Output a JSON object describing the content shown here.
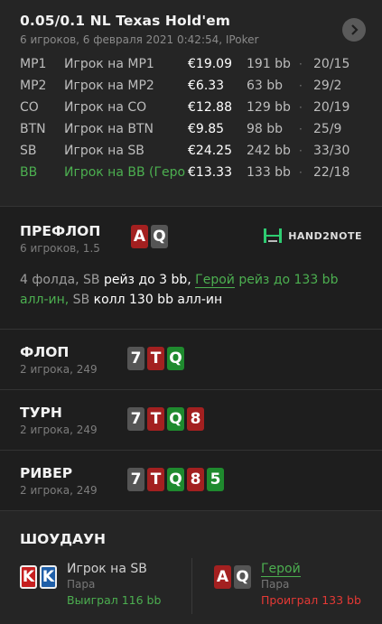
{
  "header": {
    "title": "0.05/0.1 NL Texas Hold'em",
    "subtitle": "6 игроков, 6 февраля 2021 0:42:54, IPoker",
    "nav_icon": "chevron-right-icon"
  },
  "players": [
    {
      "pos": "MP1",
      "name": "Игрок на MP1",
      "stack": "€19.09",
      "bb": "191 bb",
      "sep": "·",
      "stats": "20/15"
    },
    {
      "pos": "MP2",
      "name": "Игрок на MP2",
      "stack": "€6.33",
      "bb": "63 bb",
      "sep": "·",
      "stats": "29/2"
    },
    {
      "pos": "CO",
      "name": "Игрок на CO",
      "stack": "€12.88",
      "bb": "129 bb",
      "sep": "·",
      "stats": "20/19"
    },
    {
      "pos": "BTN",
      "name": "Игрок на BTN",
      "stack": "€9.85",
      "bb": "98 bb",
      "sep": "·",
      "stats": "25/9"
    },
    {
      "pos": "SB",
      "name": "Игрок на SB",
      "stack": "€24.25",
      "bb": "242 bb",
      "sep": "·",
      "stats": "33/30"
    },
    {
      "pos": "BB",
      "name": "Игрок на BB (Геро",
      "stack": "€13.33",
      "bb": "133 bb",
      "sep": "·",
      "stats": "22/18"
    }
  ],
  "preflop": {
    "title": "ПРЕФЛОП",
    "sub": "6 игроков, 1.5",
    "cards": [
      "A",
      "Q"
    ],
    "brand": "HAND2NOTE",
    "action": {
      "p1": "4 фолда, SB",
      "p2": " рейз до 3 bb, ",
      "p3": "Герой",
      "p4": " рейз до 133 bb",
      "p5": "алл-ин,",
      "p6": " SB",
      "p7": " колл 130 bb алл-ин"
    }
  },
  "flop": {
    "title": "ФЛОП",
    "sub": "2 игрока, 249",
    "cards": [
      "7",
      "T",
      "Q"
    ]
  },
  "turn": {
    "title": "ТУРН",
    "sub": "2 игрока, 249",
    "cards": [
      "7",
      "T",
      "Q",
      "8"
    ]
  },
  "river": {
    "title": "РИВЕР",
    "sub": "2 игрока, 249",
    "cards": [
      "7",
      "T",
      "Q",
      "8",
      "5"
    ]
  },
  "showdown": {
    "title": "ШОУДАУН",
    "left": {
      "cards": [
        "K",
        "K"
      ],
      "name": "Игрок на SB",
      "hand": "Пара",
      "result": "Выиграл 116 bb"
    },
    "right": {
      "cards": [
        "A",
        "Q"
      ],
      "name": "Герой",
      "hand": "Пара",
      "result": "Проиграл 133 bb"
    }
  },
  "colors": {
    "win": "#4caf50",
    "lose": "#e53935",
    "hero": "#4caf50"
  }
}
